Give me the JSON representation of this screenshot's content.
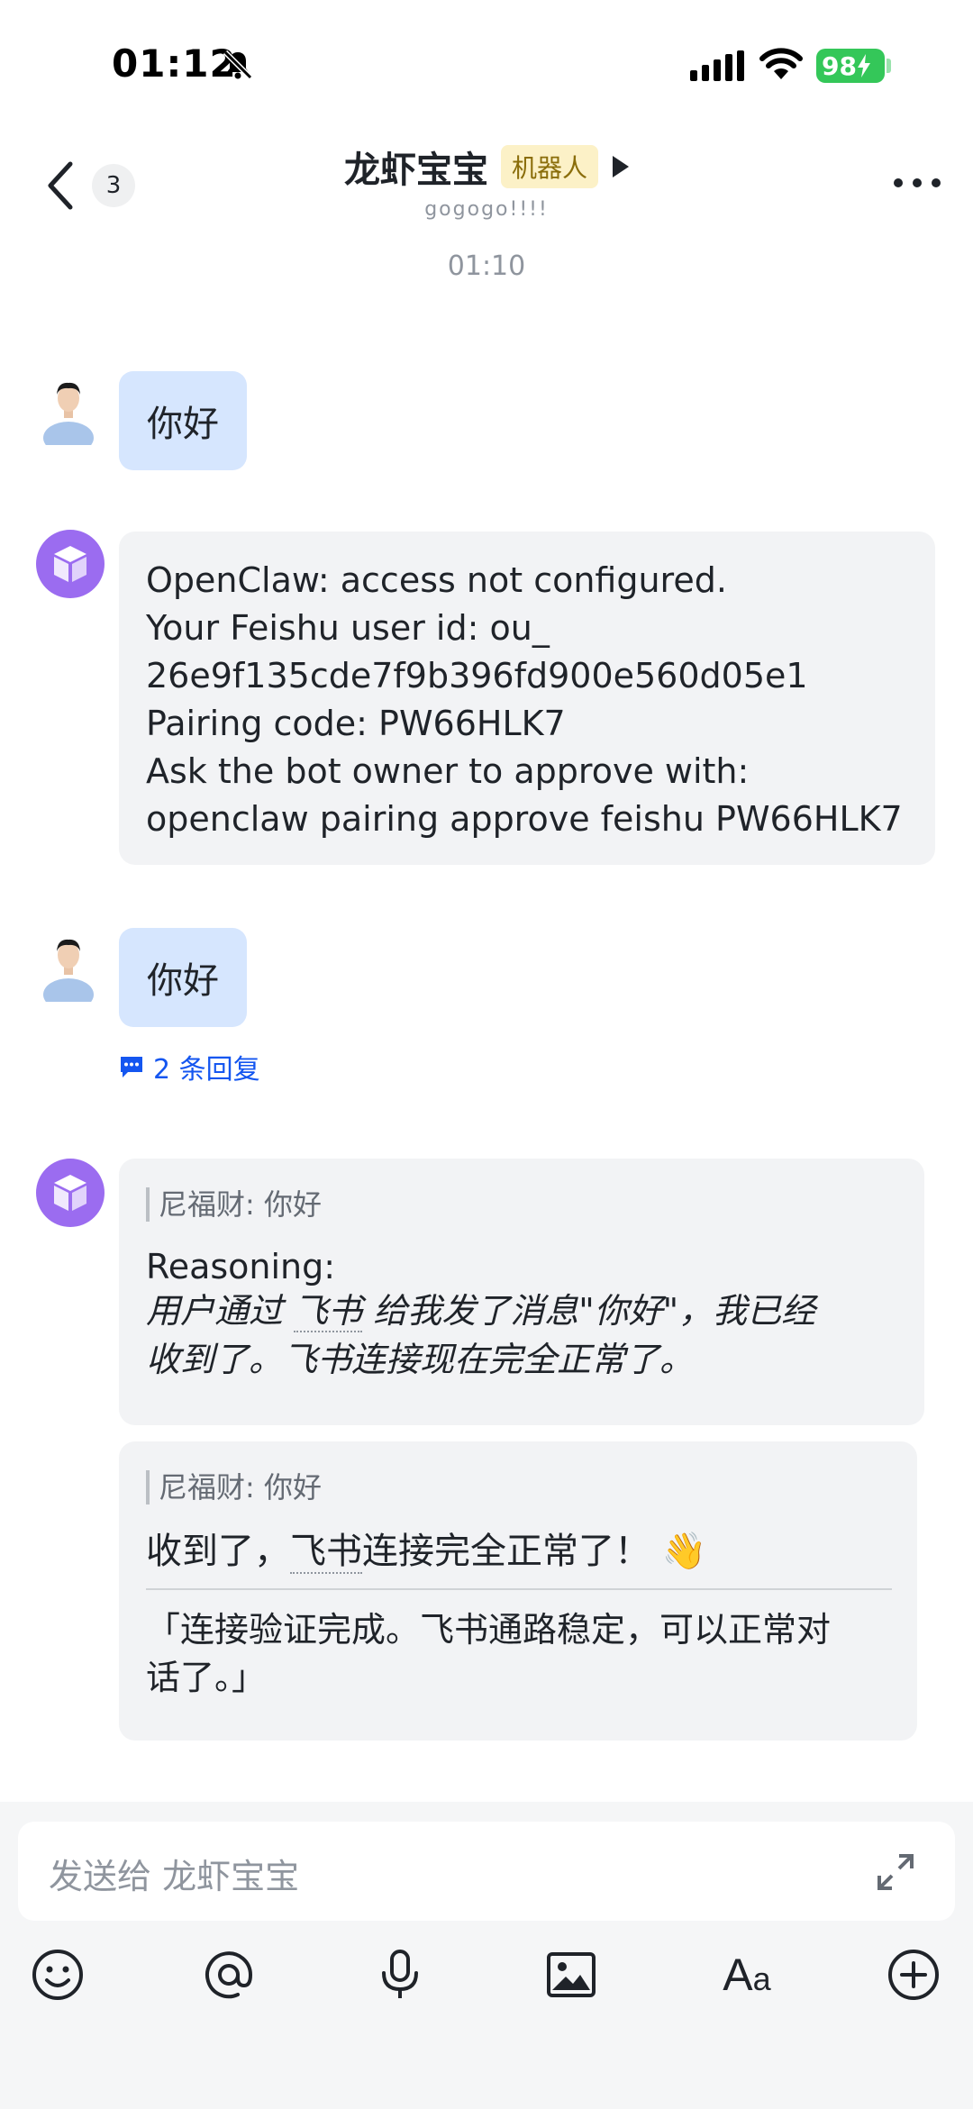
{
  "status": {
    "time": "01:12",
    "battery": "98"
  },
  "header": {
    "back_count": "3",
    "title": "龙虾宝宝",
    "badge": "机器人",
    "subtitle": "gogogo!!!!"
  },
  "timestamp": "01:10",
  "messages": [
    {
      "sender": "user",
      "text": "你好"
    },
    {
      "sender": "bot",
      "lines": [
        "OpenClaw: access not configured.",
        "Your Feishu user id: ou_",
        "26e9f135cde7f9b396fd900e560d05e1",
        "Pairing code: PW66HLK7",
        "Ask the bot owner to approve with:",
        "openclaw pairing approve feishu PW66HLK7"
      ]
    },
    {
      "sender": "user",
      "text": "你好",
      "reply_count": "2 条回复"
    },
    {
      "sender": "bot",
      "quote": "尼福财: 你好",
      "reasoning_label": "Reasoning:",
      "reasoning_pre": "用户通过 ",
      "reasoning_link": "飞书",
      "reasoning_post1": " 给我发了消息\"你好\"，我已经",
      "reasoning_line2": "收到了。飞书连接现在完全正常了。"
    },
    {
      "sender": "bot",
      "quote": "尼福财: 你好",
      "text_pre": "收到了，",
      "text_link": "飞书",
      "text_post": "连接完全正常了！ 👋",
      "footer_line1": "「连接验证完成。飞书通路稳定，可以正常对",
      "footer_line2": "话了。」"
    }
  ],
  "input": {
    "placeholder": "发送给 龙虾宝宝"
  },
  "toolbar": [
    "emoji-icon",
    "mention-icon",
    "microphone-icon",
    "image-icon",
    "text-format-icon",
    "add-icon"
  ],
  "colors": {
    "accent": "#1456f0",
    "user_bubble": "#d6e6fe",
    "bot_bubble": "#f2f3f5",
    "bot_avatar": "#9b6cf0",
    "badge_bg": "#fcf1c7"
  }
}
